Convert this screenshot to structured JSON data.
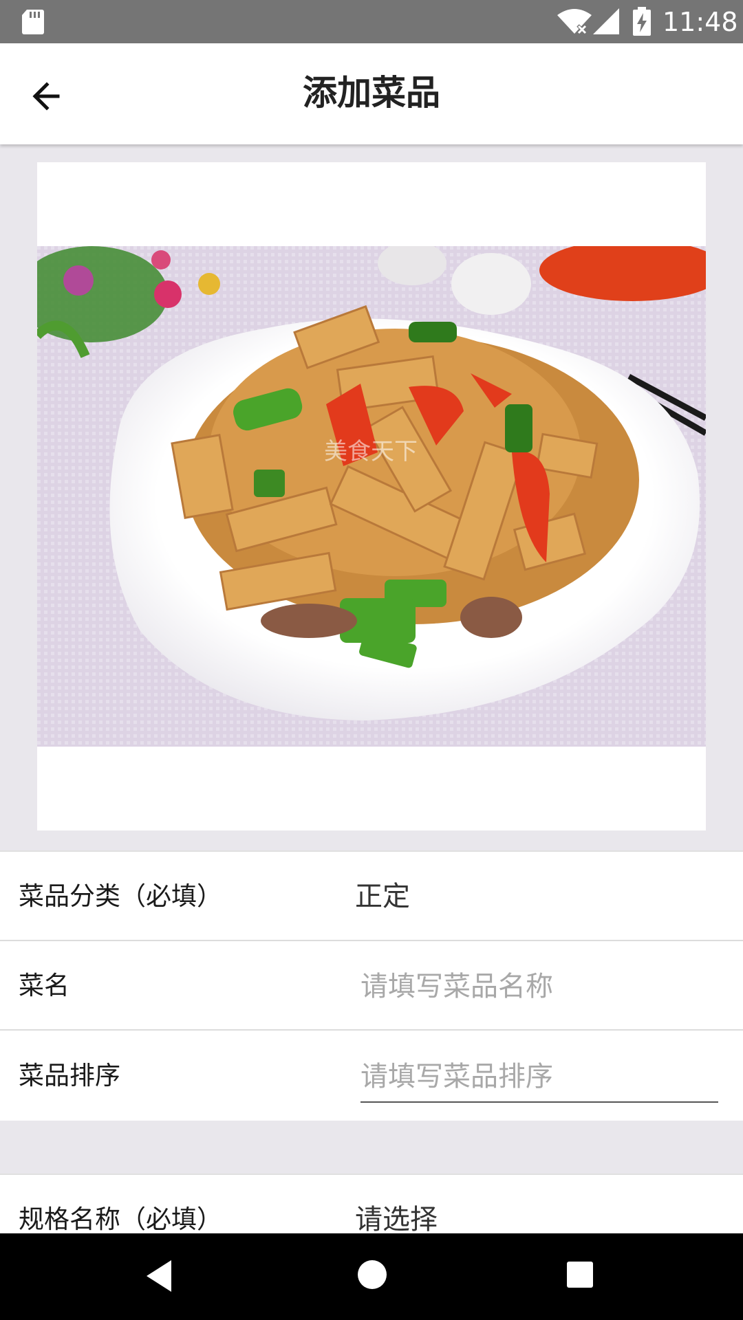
{
  "status_bar": {
    "time": "11:48",
    "icons": [
      "sd-card-icon",
      "wifi-icon",
      "cell-signal-icon",
      "battery-charging-icon"
    ]
  },
  "app_bar": {
    "title": "添加菜品",
    "back_icon": "arrow-left-icon"
  },
  "photo": {
    "watermark": "美食天下"
  },
  "form": {
    "rows": [
      {
        "label": "菜品分类（必填）",
        "value": "正定"
      },
      {
        "label": "菜名",
        "placeholder": "请填写菜品名称",
        "value": ""
      },
      {
        "label": "菜品排序",
        "placeholder": "请填写菜品排序",
        "value": ""
      }
    ]
  },
  "spec": {
    "label": "规格名称（必填）",
    "value": "请选择"
  },
  "nav_bar": {
    "icons": [
      "nav-back-icon",
      "nav-home-icon",
      "nav-recents-icon"
    ]
  },
  "colors": {
    "status_bar": "#757575",
    "background": "#e9e7ec",
    "card": "#ffffff",
    "placeholder": "#a8a8a8"
  }
}
